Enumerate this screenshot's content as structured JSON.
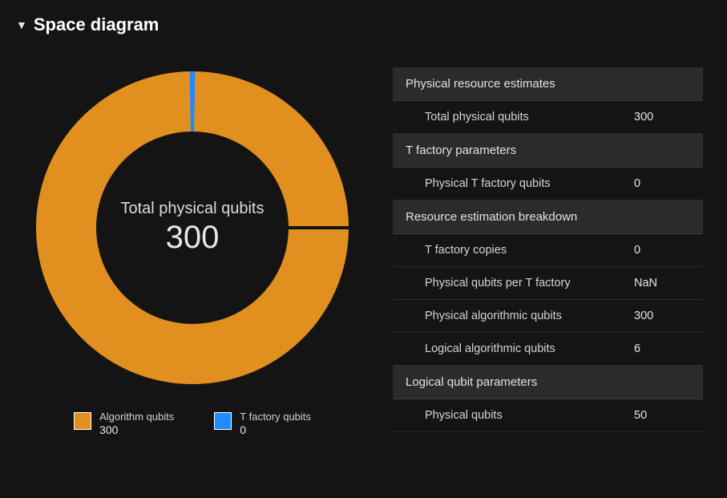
{
  "header": {
    "title": "Space diagram",
    "expanded": true
  },
  "donut": {
    "center_label": "Total physical qubits",
    "center_value": "300"
  },
  "legend": [
    {
      "name": "Algorithm qubits",
      "value": "300",
      "color": "#e18f1e"
    },
    {
      "name": "T factory qubits",
      "value": "0",
      "color": "#1f8bff"
    }
  ],
  "sections": [
    {
      "title": "Physical resource estimates",
      "rows": [
        {
          "label": "Total physical qubits",
          "value": "300"
        }
      ]
    },
    {
      "title": "T factory parameters",
      "rows": [
        {
          "label": "Physical T factory qubits",
          "value": "0"
        }
      ]
    },
    {
      "title": "Resource estimation breakdown",
      "rows": [
        {
          "label": "T factory copies",
          "value": "0"
        },
        {
          "label": "Physical qubits per T factory",
          "value": "NaN"
        },
        {
          "label": "Physical algorithmic qubits",
          "value": "300"
        },
        {
          "label": "Logical algorithmic qubits",
          "value": "6"
        }
      ]
    },
    {
      "title": "Logical qubit parameters",
      "rows": [
        {
          "label": "Physical qubits",
          "value": "50"
        }
      ]
    }
  ],
  "chart_data": {
    "type": "pie",
    "title": "Total physical qubits",
    "total": 300,
    "series": [
      {
        "name": "Algorithm qubits",
        "value": 300,
        "color": "#e18f1e"
      },
      {
        "name": "T factory qubits",
        "value": 0,
        "color": "#1f8bff"
      }
    ]
  }
}
